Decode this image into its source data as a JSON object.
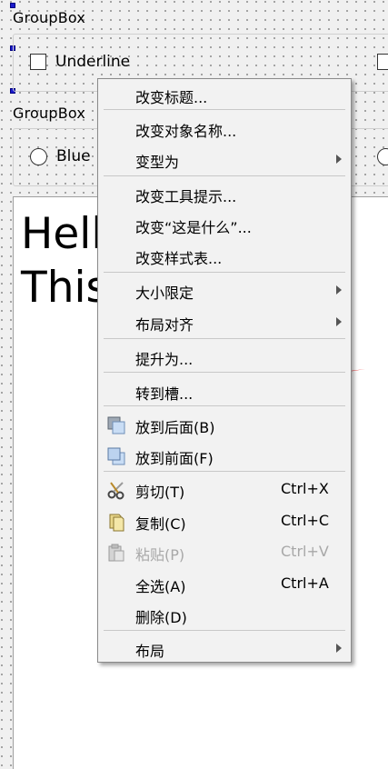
{
  "groupbox1": {
    "title": "GroupBox",
    "checkbox_label": "Underline"
  },
  "groupbox2": {
    "title": "GroupBox",
    "radio_label": "Blue"
  },
  "textedit": {
    "line1": "Hell",
    "line2": "This"
  },
  "context_menu": {
    "items": [
      {
        "label": "改变标题...",
        "shortcut": "",
        "submenu": false,
        "disabled": false,
        "icon": ""
      },
      {
        "label": "改变对象名称...",
        "shortcut": "",
        "submenu": false,
        "disabled": false,
        "icon": ""
      },
      {
        "label": "变型为",
        "shortcut": "",
        "submenu": true,
        "disabled": false,
        "icon": ""
      },
      {
        "label": "改变工具提示...",
        "shortcut": "",
        "submenu": false,
        "disabled": false,
        "icon": ""
      },
      {
        "label": "改变“这是什么”...",
        "shortcut": "",
        "submenu": false,
        "disabled": false,
        "icon": ""
      },
      {
        "label": "改变样式表...",
        "shortcut": "",
        "submenu": false,
        "disabled": false,
        "icon": ""
      },
      {
        "label": "大小限定",
        "shortcut": "",
        "submenu": true,
        "disabled": false,
        "icon": ""
      },
      {
        "label": "布局对齐",
        "shortcut": "",
        "submenu": true,
        "disabled": false,
        "icon": ""
      },
      {
        "label": "提升为...",
        "shortcut": "",
        "submenu": false,
        "disabled": false,
        "icon": ""
      },
      {
        "label": "转到槽...",
        "shortcut": "",
        "submenu": false,
        "disabled": false,
        "icon": ""
      },
      {
        "label": "放到后面(B)",
        "shortcut": "",
        "submenu": false,
        "disabled": false,
        "icon": "send-to-back-icon"
      },
      {
        "label": "放到前面(F)",
        "shortcut": "",
        "submenu": false,
        "disabled": false,
        "icon": "bring-to-front-icon"
      },
      {
        "label": "剪切(T)",
        "shortcut": "Ctrl+X",
        "submenu": false,
        "disabled": false,
        "icon": "scissors-icon"
      },
      {
        "label": "复制(C)",
        "shortcut": "Ctrl+C",
        "submenu": false,
        "disabled": false,
        "icon": "copy-icon"
      },
      {
        "label": "粘贴(P)",
        "shortcut": "Ctrl+V",
        "submenu": false,
        "disabled": true,
        "icon": "paste-icon"
      },
      {
        "label": "全选(A)",
        "shortcut": "Ctrl+A",
        "submenu": false,
        "disabled": false,
        "icon": ""
      },
      {
        "label": "删除(D)",
        "shortcut": "",
        "submenu": false,
        "disabled": false,
        "icon": ""
      },
      {
        "label": "布局",
        "shortcut": "",
        "submenu": true,
        "disabled": false,
        "icon": ""
      }
    ]
  },
  "annotation": {
    "arrow_color": "#ee1c1c"
  },
  "colors": {
    "selection_handle": "#1a1acc",
    "disabled_text": "#a8a8a8"
  }
}
